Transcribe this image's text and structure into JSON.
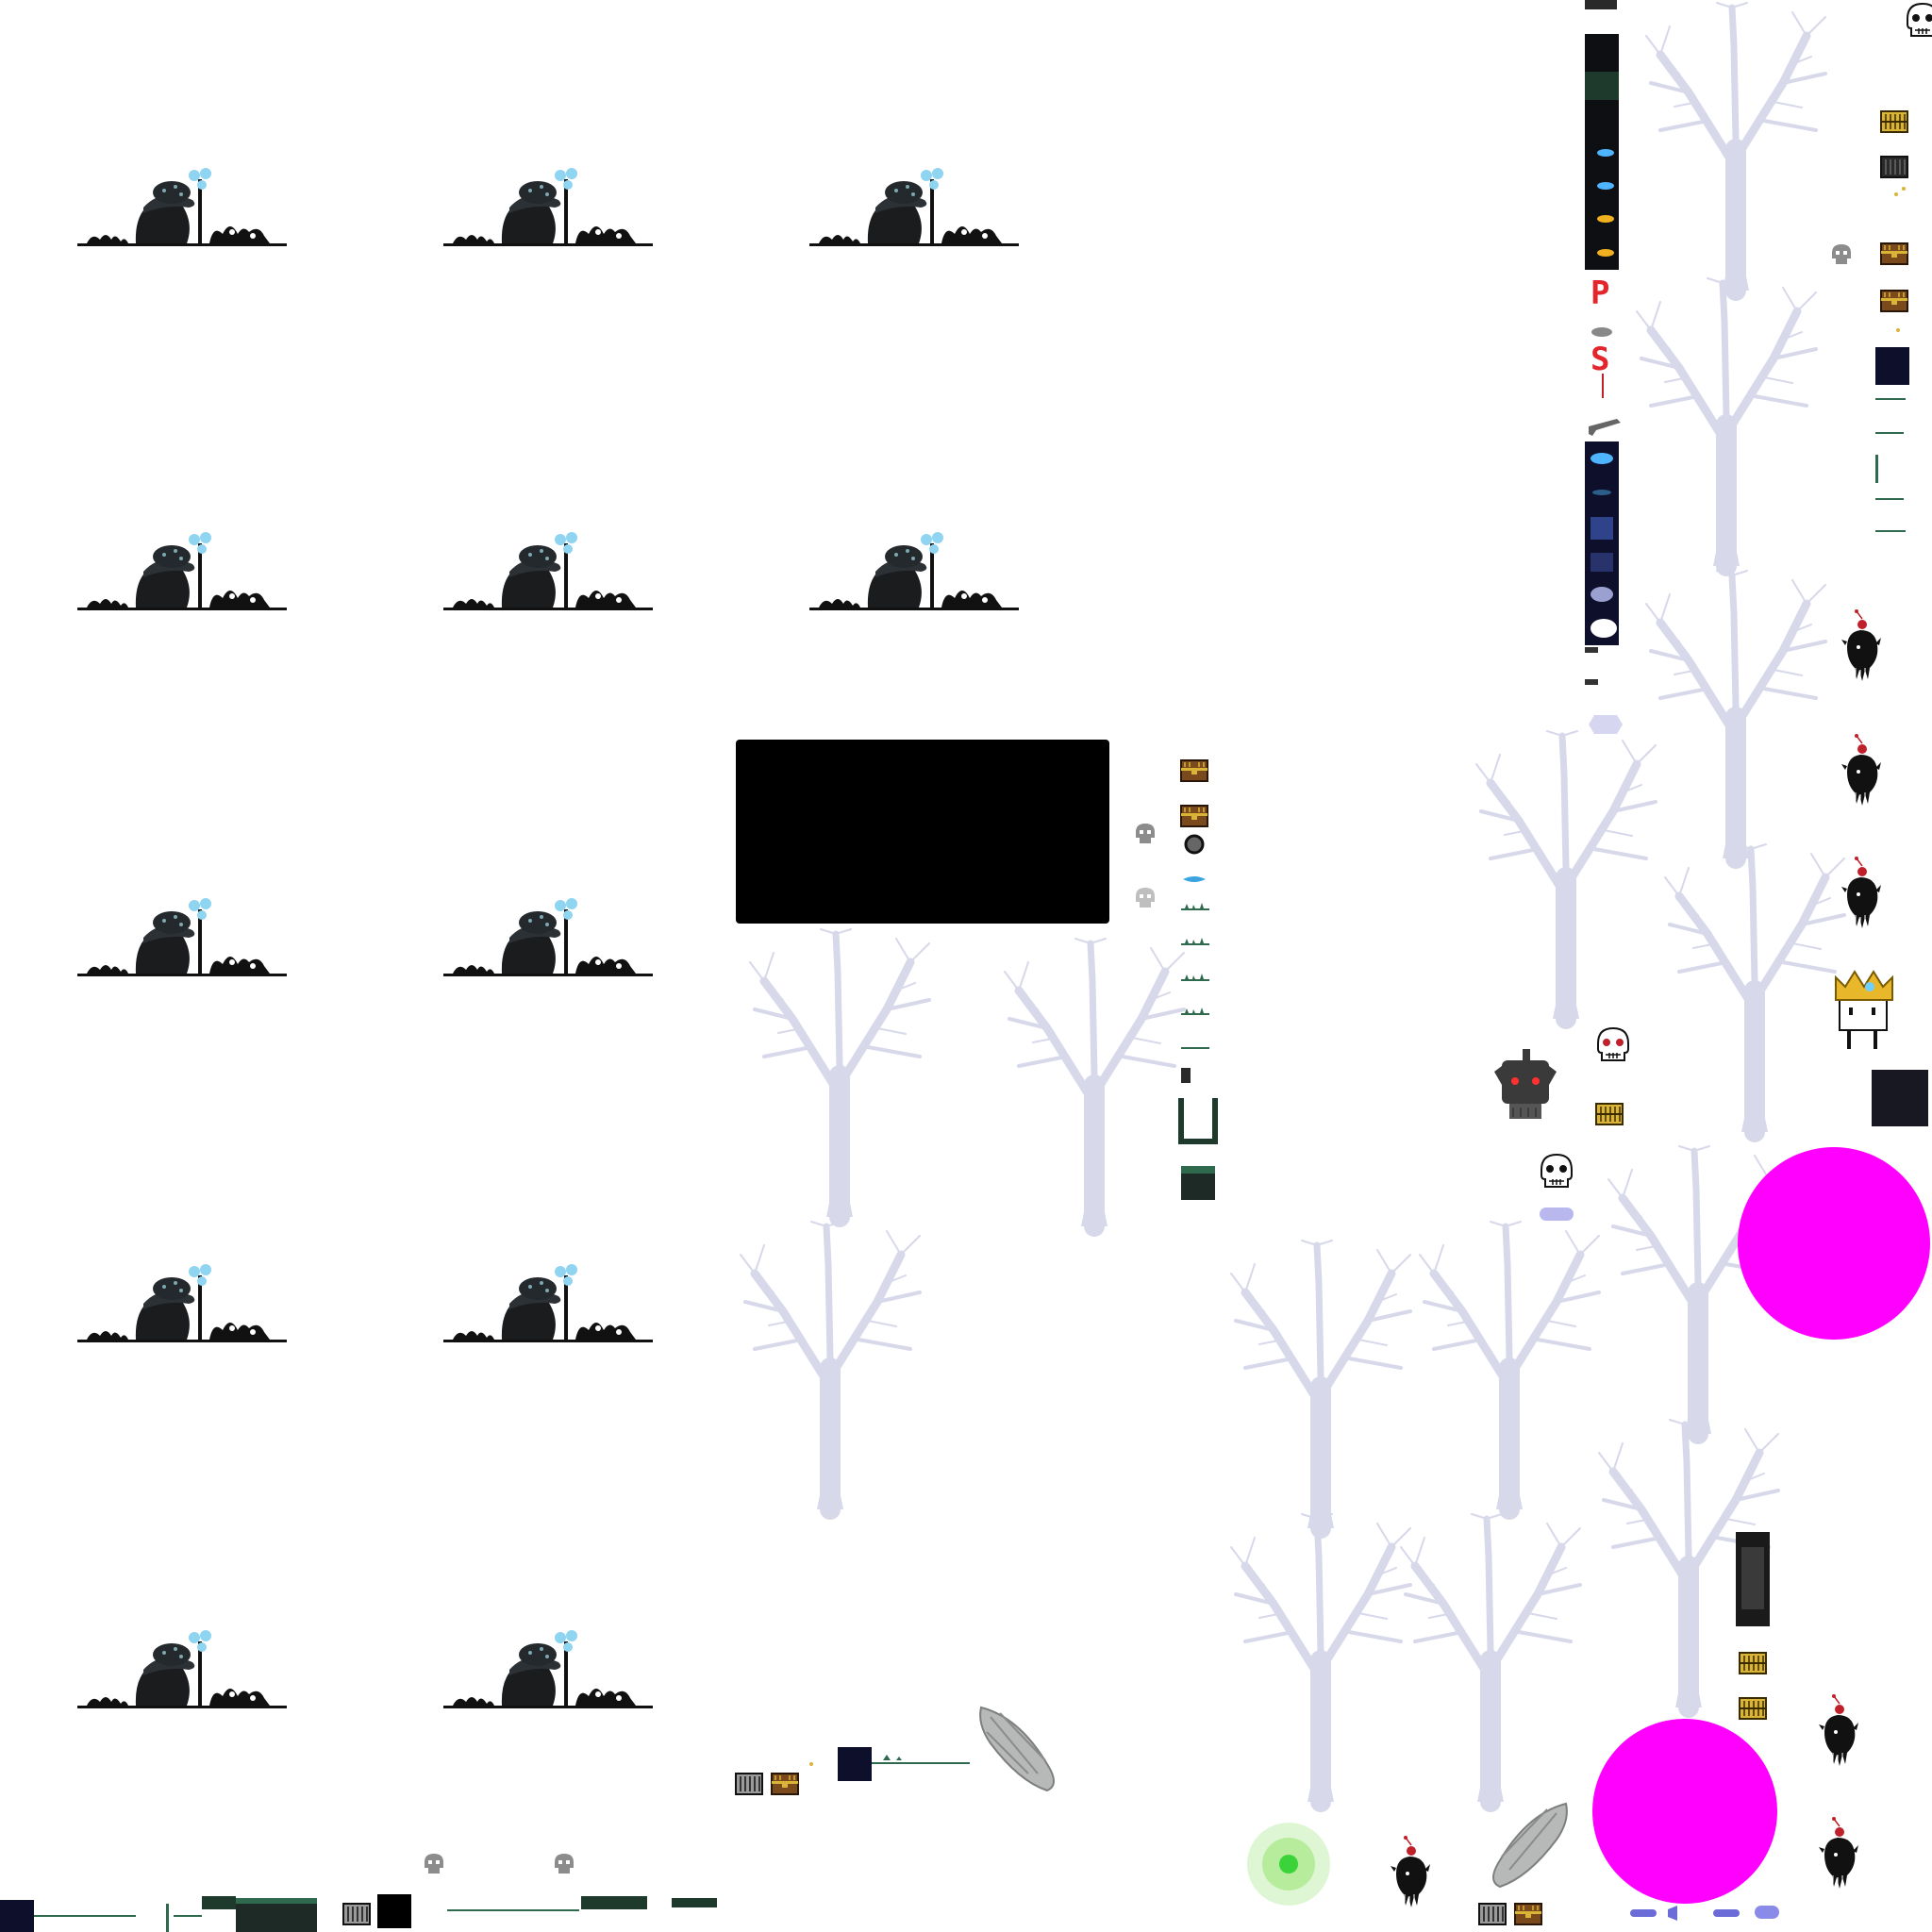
{
  "sheet": {
    "background": "#ffffff",
    "colors": {
      "tree": "#d7d8ea",
      "ink": "#111111",
      "glow_blue": "#8fd4f0",
      "magenta": "#ff00ff",
      "gold": "#d9b437",
      "wood": "#7a4a1c",
      "moss": "#2f6a4e",
      "red_letter": "#e3262b",
      "lavender": "#b8b8ef"
    }
  },
  "glyphs": {
    "letter_p": "P",
    "letter_s": "S"
  },
  "icons": {
    "mushroom_scene": "mushroom-hermit-scene",
    "tree": "dead-tree",
    "skull": "skull-icon",
    "chest": "chest-icon",
    "crown_character": "crowned-character",
    "heart_creature": "heart-shadow-creature",
    "robot_head": "robot-head",
    "wing": "angel-wing",
    "orb": "magenta-orb",
    "glow": "green-glow"
  }
}
